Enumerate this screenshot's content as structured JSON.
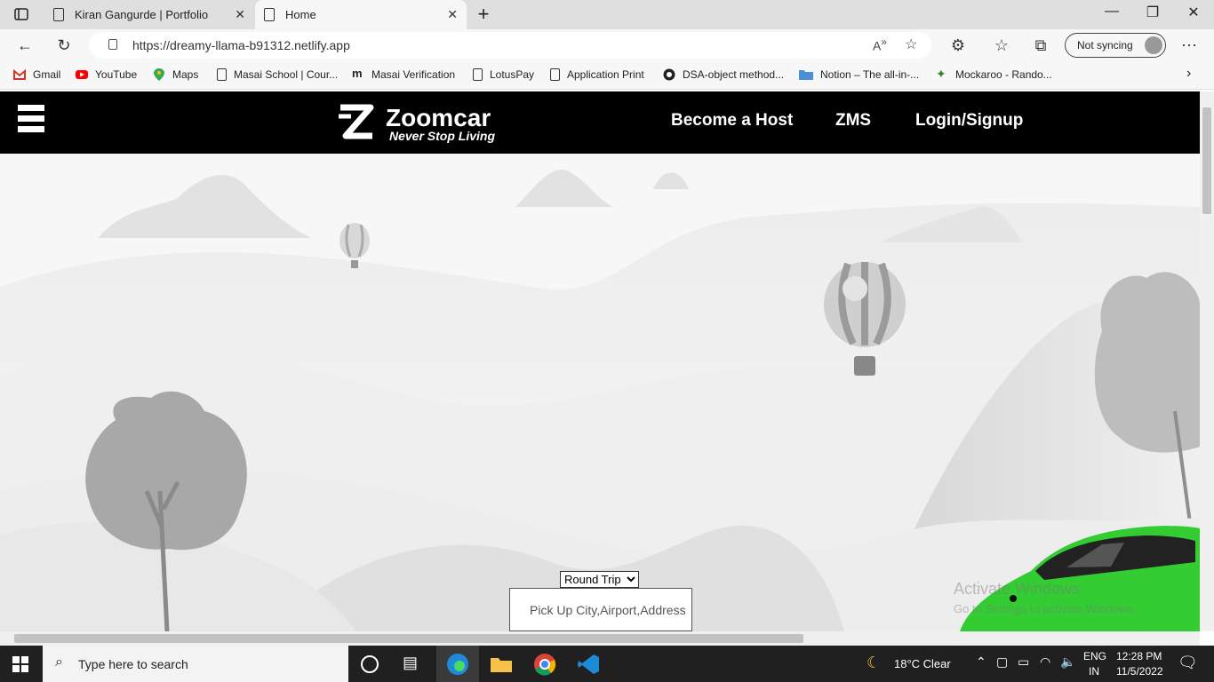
{
  "browser": {
    "tabs": [
      {
        "title": "Kiran Gangurde | Portfolio"
      },
      {
        "title": "Home",
        "active": true
      }
    ],
    "url": "https://dreamy-llama-b91312.netlify.app",
    "sync_label": "Not syncing",
    "bookmarks": [
      {
        "label": "Gmail",
        "icon": "gmail-icon"
      },
      {
        "label": "YouTube",
        "icon": "youtube-icon"
      },
      {
        "label": "Maps",
        "icon": "maps-icon"
      },
      {
        "label": "Masai School | Cour...",
        "icon": "page-icon"
      },
      {
        "label": "Masai Verification",
        "icon": "masai-icon"
      },
      {
        "label": "LotusPay",
        "icon": "page-icon"
      },
      {
        "label": "Application Print",
        "icon": "page-icon"
      },
      {
        "label": "DSA-object method...",
        "icon": "github-icon"
      },
      {
        "label": "Notion – The all-in-...",
        "icon": "folder-icon"
      },
      {
        "label": "Mockaroo - Rando...",
        "icon": "mockaroo-icon"
      }
    ]
  },
  "site": {
    "brand": "Zoomcar",
    "tagline": "Never Stop Living",
    "nav": [
      {
        "label": "Become a Host"
      },
      {
        "label": "ZMS"
      },
      {
        "label": "Login/Signup"
      }
    ],
    "trip_select": {
      "selected": "Round Trip"
    },
    "pickup_placeholder": "Pick Up City,Airport,Address",
    "colors": {
      "header_bg": "#000000",
      "car_green": "#33cc33"
    }
  },
  "watermark": {
    "line1": "Activate Windows",
    "line2": "Go to Settings to activate Windows."
  },
  "taskbar": {
    "search_placeholder": "Type here to search",
    "weather": "18°C  Clear",
    "lang_line1": "ENG",
    "lang_line2": "IN",
    "time": "12:28 PM",
    "date": "11/5/2022"
  }
}
